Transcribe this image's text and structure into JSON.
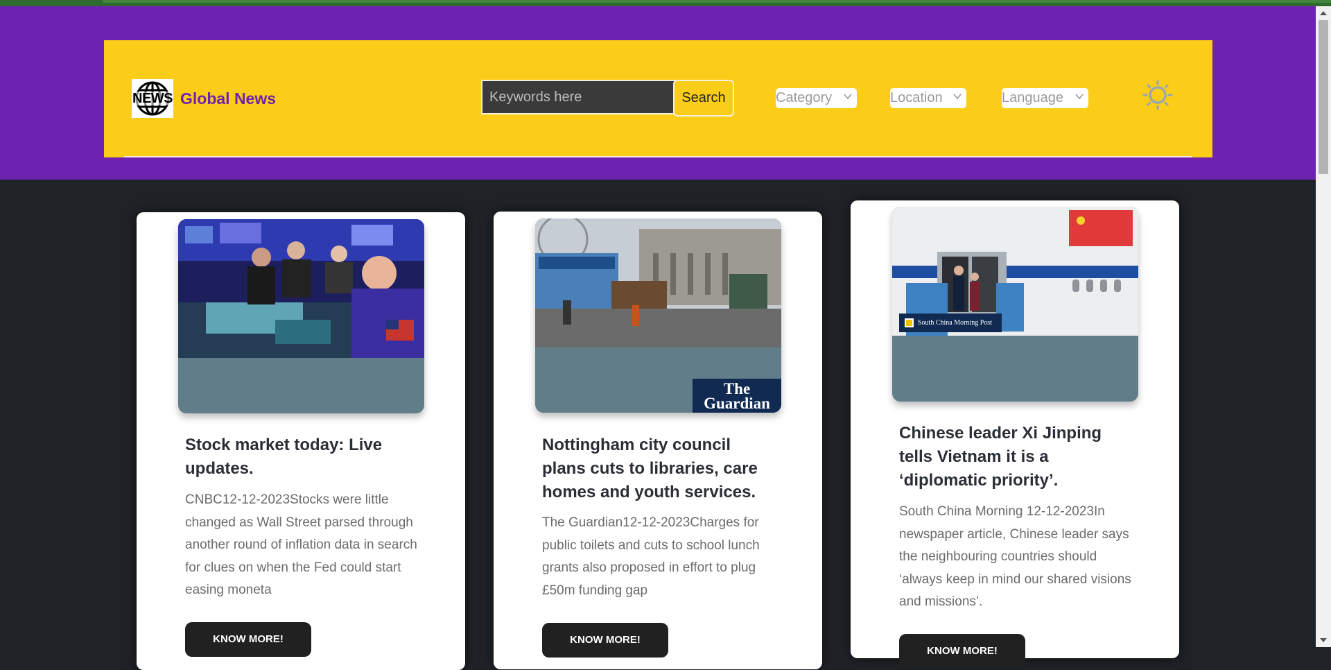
{
  "brand": {
    "logo_text": "NEWS",
    "name": "Global News"
  },
  "search": {
    "placeholder": "Keywords here",
    "button_label": "Search"
  },
  "filters": {
    "category": "Category",
    "location": "Location",
    "language": "Language"
  },
  "theme_toggle_icon": "sun-icon",
  "colors": {
    "header_band": "#6e22b0",
    "navbar": "#fbcd18",
    "page_background": "#1f2327",
    "card_media_background": "#627d8a",
    "button": "#212121"
  },
  "cards": [
    {
      "title": "Stock market today: Live updates.",
      "description": "CNBC12-12-2023Stocks were little changed as Wall Street parsed through another round of inflation data in search for clues on when the Fed could start easing moneta",
      "button_label": "KNOW MORE!"
    },
    {
      "title": "Nottingham city council plans cuts to libraries, care homes and youth services.",
      "description": "The Guardian12-12-2023Charges for public toilets and cuts to school lunch grants also proposed in effort to plug £50m funding gap",
      "button_label": "KNOW MORE!",
      "image_badge": "The Guardian"
    },
    {
      "title": "Chinese leader Xi Jinping tells Vietnam it is a ‘diplomatic priority’.",
      "description": "South China Morning 12-12-2023In newspaper article, Chinese leader says the neighbouring countries should ‘always keep in mind our shared visions and missions’.",
      "button_label": "KNOW MORE!",
      "image_badge": "South China Morning Post"
    }
  ]
}
